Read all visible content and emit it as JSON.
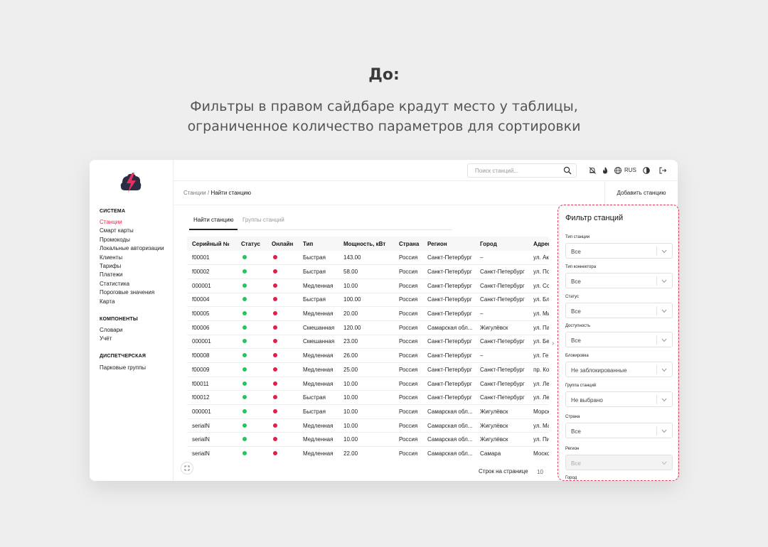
{
  "hero": {
    "title": "До:",
    "subtitle_line1": "Фильтры в правом сайдбаре крадут место у таблицы,",
    "subtitle_line2": "ограниченное количество параметров для сортировки"
  },
  "colors": {
    "accent": "#e8274a",
    "online_green": "#22c55e",
    "offline_red": "#e11d48"
  },
  "sidebar": {
    "sections": [
      {
        "title": "СИСТЕМА",
        "items": [
          {
            "label": "Станции",
            "active": true
          },
          {
            "label": "Смарт карты"
          },
          {
            "label": "Промокоды"
          },
          {
            "label": "Локальные авторизации"
          },
          {
            "label": "Клиенты"
          },
          {
            "label": "Тарифы"
          },
          {
            "label": "Платежи"
          },
          {
            "label": "Статистика"
          },
          {
            "label": "Пороговые значения"
          },
          {
            "label": "Карта"
          }
        ]
      },
      {
        "title": "КОМПОНЕНТЫ",
        "items": [
          {
            "label": "Словари"
          },
          {
            "label": "Учёт"
          }
        ]
      },
      {
        "title": "ДИСПЕТЧЕРСКАЯ",
        "items": [
          {
            "label": "Парковые группы"
          }
        ]
      }
    ]
  },
  "topbar": {
    "search_placeholder": "Поиск станций...",
    "language": "RUS",
    "icons": [
      "bell-off-icon",
      "flame-icon",
      "globe-icon",
      "theme-toggle-icon",
      "logout-icon"
    ]
  },
  "breadcrumb": {
    "root": "Станции",
    "separator": "/",
    "current": "Найти станцию"
  },
  "add_station_label": "Добавить станцию",
  "tabs": [
    {
      "label": "Найти станцию",
      "active": true
    },
    {
      "label": "Группы станций"
    }
  ],
  "table": {
    "columns": [
      "Серийный №",
      "Статус",
      "Онлайн",
      "Тип",
      "Мощность, кВт",
      "Страна",
      "Регион",
      "Город",
      "Адрес"
    ],
    "rows": [
      [
        "f00001",
        "green",
        "red",
        "Быстрая",
        "143.00",
        "Россия",
        "Санкт-Петербург",
        "–",
        "ул. Ак"
      ],
      [
        "f00002",
        "green",
        "red",
        "Быстрая",
        "58.00",
        "Россия",
        "Санкт-Петербург",
        "Санкт-Петербург",
        "ул. По"
      ],
      [
        "000001",
        "green",
        "red",
        "Медленная",
        "10.00",
        "Россия",
        "Санкт-Петербург",
        "Санкт-Петербург",
        "ул. Со"
      ],
      [
        "f00004",
        "green",
        "red",
        "Быстрая",
        "100.00",
        "Россия",
        "Санкт-Петербург",
        "Санкт-Петербург",
        "ул. Бл"
      ],
      [
        "f00005",
        "green",
        "red",
        "Медленная",
        "20.00",
        "Россия",
        "Санкт-Петербург",
        "–",
        "ул. Ми"
      ],
      [
        "f00006",
        "green",
        "red",
        "Смешанная",
        "120.00",
        "Россия",
        "Самарская обл...",
        "Жигулёвск",
        "ул. Па"
      ],
      [
        "000001",
        "green",
        "red",
        "Смешанная",
        "23.00",
        "Россия",
        "Санкт-Петербург",
        "Санкт-Петербург",
        "ул. Бе"
      ],
      [
        "f00008",
        "green",
        "red",
        "Медленная",
        "26.00",
        "Россия",
        "Санкт-Петербург",
        "–",
        "ул. Ге"
      ],
      [
        "f00009",
        "green",
        "red",
        "Медленная",
        "25.00",
        "Россия",
        "Санкт-Петербург",
        "Санкт-Петербург",
        "пр. Ко"
      ],
      [
        "f00011",
        "green",
        "red",
        "Медленная",
        "10.00",
        "Россия",
        "Санкт-Петербург",
        "Санкт-Петербург",
        "ул. Ле"
      ],
      [
        "f00012",
        "green",
        "red",
        "Быстрая",
        "10.00",
        "Россия",
        "Санкт-Петербург",
        "Санкт-Петербург",
        "ул. Ле"
      ],
      [
        "000001",
        "green",
        "red",
        "Быстрая",
        "10.00",
        "Россия",
        "Самарская обл...",
        "Жигулёвск",
        "Морск"
      ],
      [
        "serialN",
        "green",
        "red",
        "Медленная",
        "10.00",
        "Россия",
        "Самарская обл...",
        "Жигулёвск",
        "ул. Ма"
      ],
      [
        "serialN",
        "green",
        "red",
        "Медленная",
        "10.00",
        "Россия",
        "Самарская обл...",
        "Жигулёвск",
        "ул. Пи"
      ],
      [
        "serialN",
        "green",
        "red",
        "Медленная",
        "22.00",
        "Россия",
        "Самарская обл...",
        "Самара",
        "Моско"
      ]
    ]
  },
  "pagination": {
    "rows_per_page_label": "Строк на странице",
    "rows_per_page_value": "10"
  },
  "filter": {
    "title": "Фильтр станций",
    "fields": [
      {
        "label": "Тип станции",
        "value": "Все"
      },
      {
        "label": "Тип коннектора",
        "value": "Все"
      },
      {
        "label": "Статус",
        "value": "Все"
      },
      {
        "label": "Доступность",
        "value": "Все"
      },
      {
        "label": "Блокировка",
        "value": "Не заблокированные"
      },
      {
        "label": "Группа станций",
        "value": "Не выбрано"
      },
      {
        "label": "Страна",
        "value": "Все"
      },
      {
        "label": "Регион",
        "value": "Все",
        "disabled": true
      },
      {
        "label": "Город",
        "value": ""
      }
    ]
  }
}
